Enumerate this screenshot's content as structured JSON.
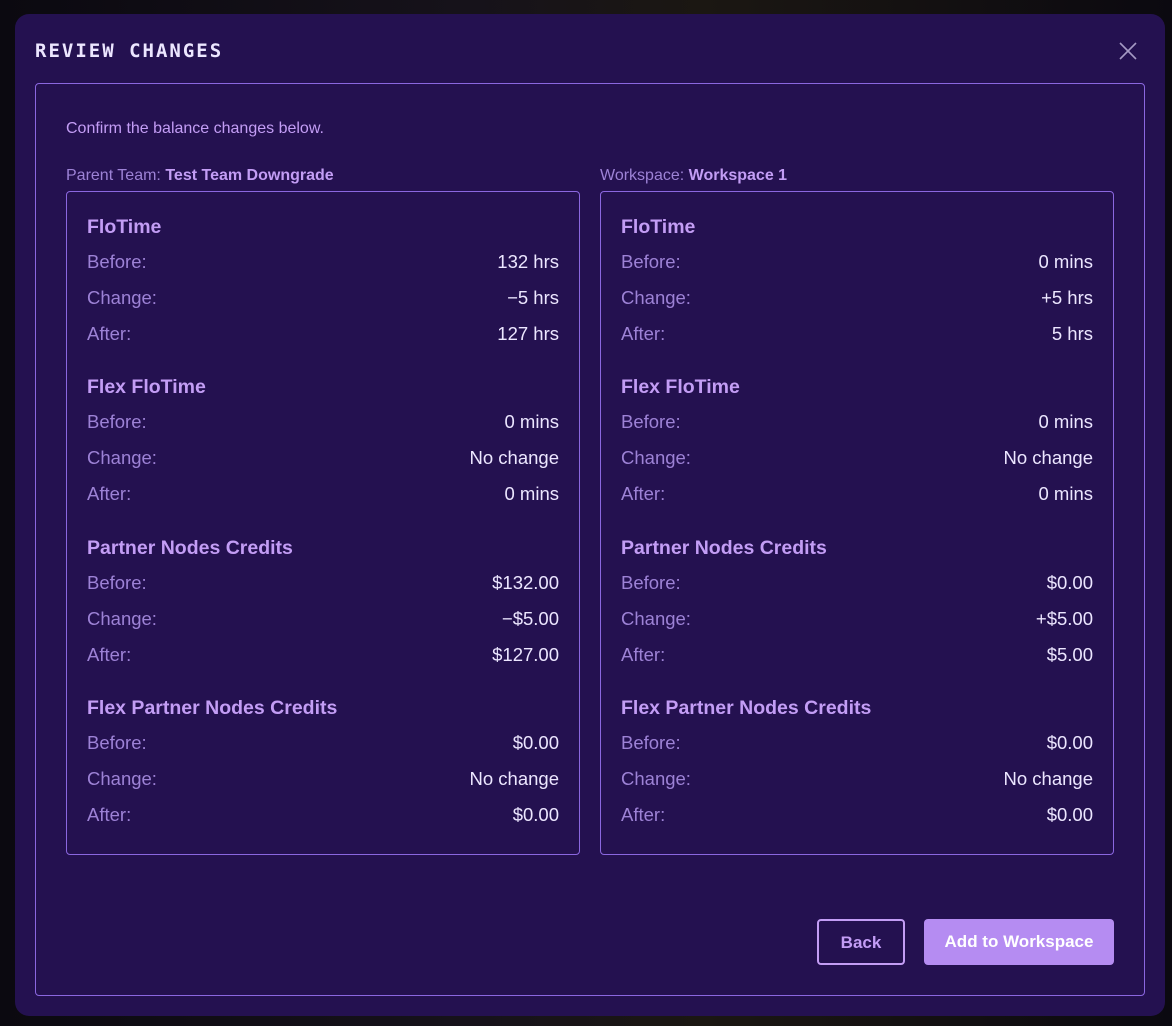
{
  "colors": {
    "modal_bg": "#241150",
    "border": "#8b67e0",
    "accent": "#c39df5",
    "muted": "#9d82d6",
    "value_text": "#ece6ff",
    "primary_button": "#b58cf2"
  },
  "modal": {
    "title": "REVIEW CHANGES",
    "close_icon": "close-icon",
    "intro": "Confirm the balance changes below."
  },
  "left": {
    "label_prefix": "Parent Team:",
    "label_name": "Test Team Downgrade",
    "sections": [
      {
        "title": "FloTime",
        "rows": [
          {
            "label": "Before:",
            "value": "132 hrs"
          },
          {
            "label": "Change:",
            "value": "−5 hrs"
          },
          {
            "label": "After:",
            "value": "127 hrs"
          }
        ]
      },
      {
        "title": "Flex FloTime",
        "rows": [
          {
            "label": "Before:",
            "value": "0 mins"
          },
          {
            "label": "Change:",
            "value": "No change"
          },
          {
            "label": "After:",
            "value": "0 mins"
          }
        ]
      },
      {
        "title": "Partner Nodes Credits",
        "rows": [
          {
            "label": "Before:",
            "value": "$132.00"
          },
          {
            "label": "Change:",
            "value": "−$5.00"
          },
          {
            "label": "After:",
            "value": "$127.00"
          }
        ]
      },
      {
        "title": "Flex Partner Nodes Credits",
        "rows": [
          {
            "label": "Before:",
            "value": "$0.00"
          },
          {
            "label": "Change:",
            "value": "No change"
          },
          {
            "label": "After:",
            "value": "$0.00"
          }
        ]
      }
    ]
  },
  "right": {
    "label_prefix": "Workspace:",
    "label_name": "Workspace 1",
    "sections": [
      {
        "title": "FloTime",
        "rows": [
          {
            "label": "Before:",
            "value": "0 mins"
          },
          {
            "label": "Change:",
            "value": "+5 hrs"
          },
          {
            "label": "After:",
            "value": "5 hrs"
          }
        ]
      },
      {
        "title": "Flex FloTime",
        "rows": [
          {
            "label": "Before:",
            "value": "0 mins"
          },
          {
            "label": "Change:",
            "value": "No change"
          },
          {
            "label": "After:",
            "value": "0 mins"
          }
        ]
      },
      {
        "title": "Partner Nodes Credits",
        "rows": [
          {
            "label": "Before:",
            "value": "$0.00"
          },
          {
            "label": "Change:",
            "value": "+$5.00"
          },
          {
            "label": "After:",
            "value": "$5.00"
          }
        ]
      },
      {
        "title": "Flex Partner Nodes Credits",
        "rows": [
          {
            "label": "Before:",
            "value": "$0.00"
          },
          {
            "label": "Change:",
            "value": "No change"
          },
          {
            "label": "After:",
            "value": "$0.00"
          }
        ]
      }
    ]
  },
  "buttons": {
    "back": "Back",
    "add": "Add to Workspace"
  }
}
